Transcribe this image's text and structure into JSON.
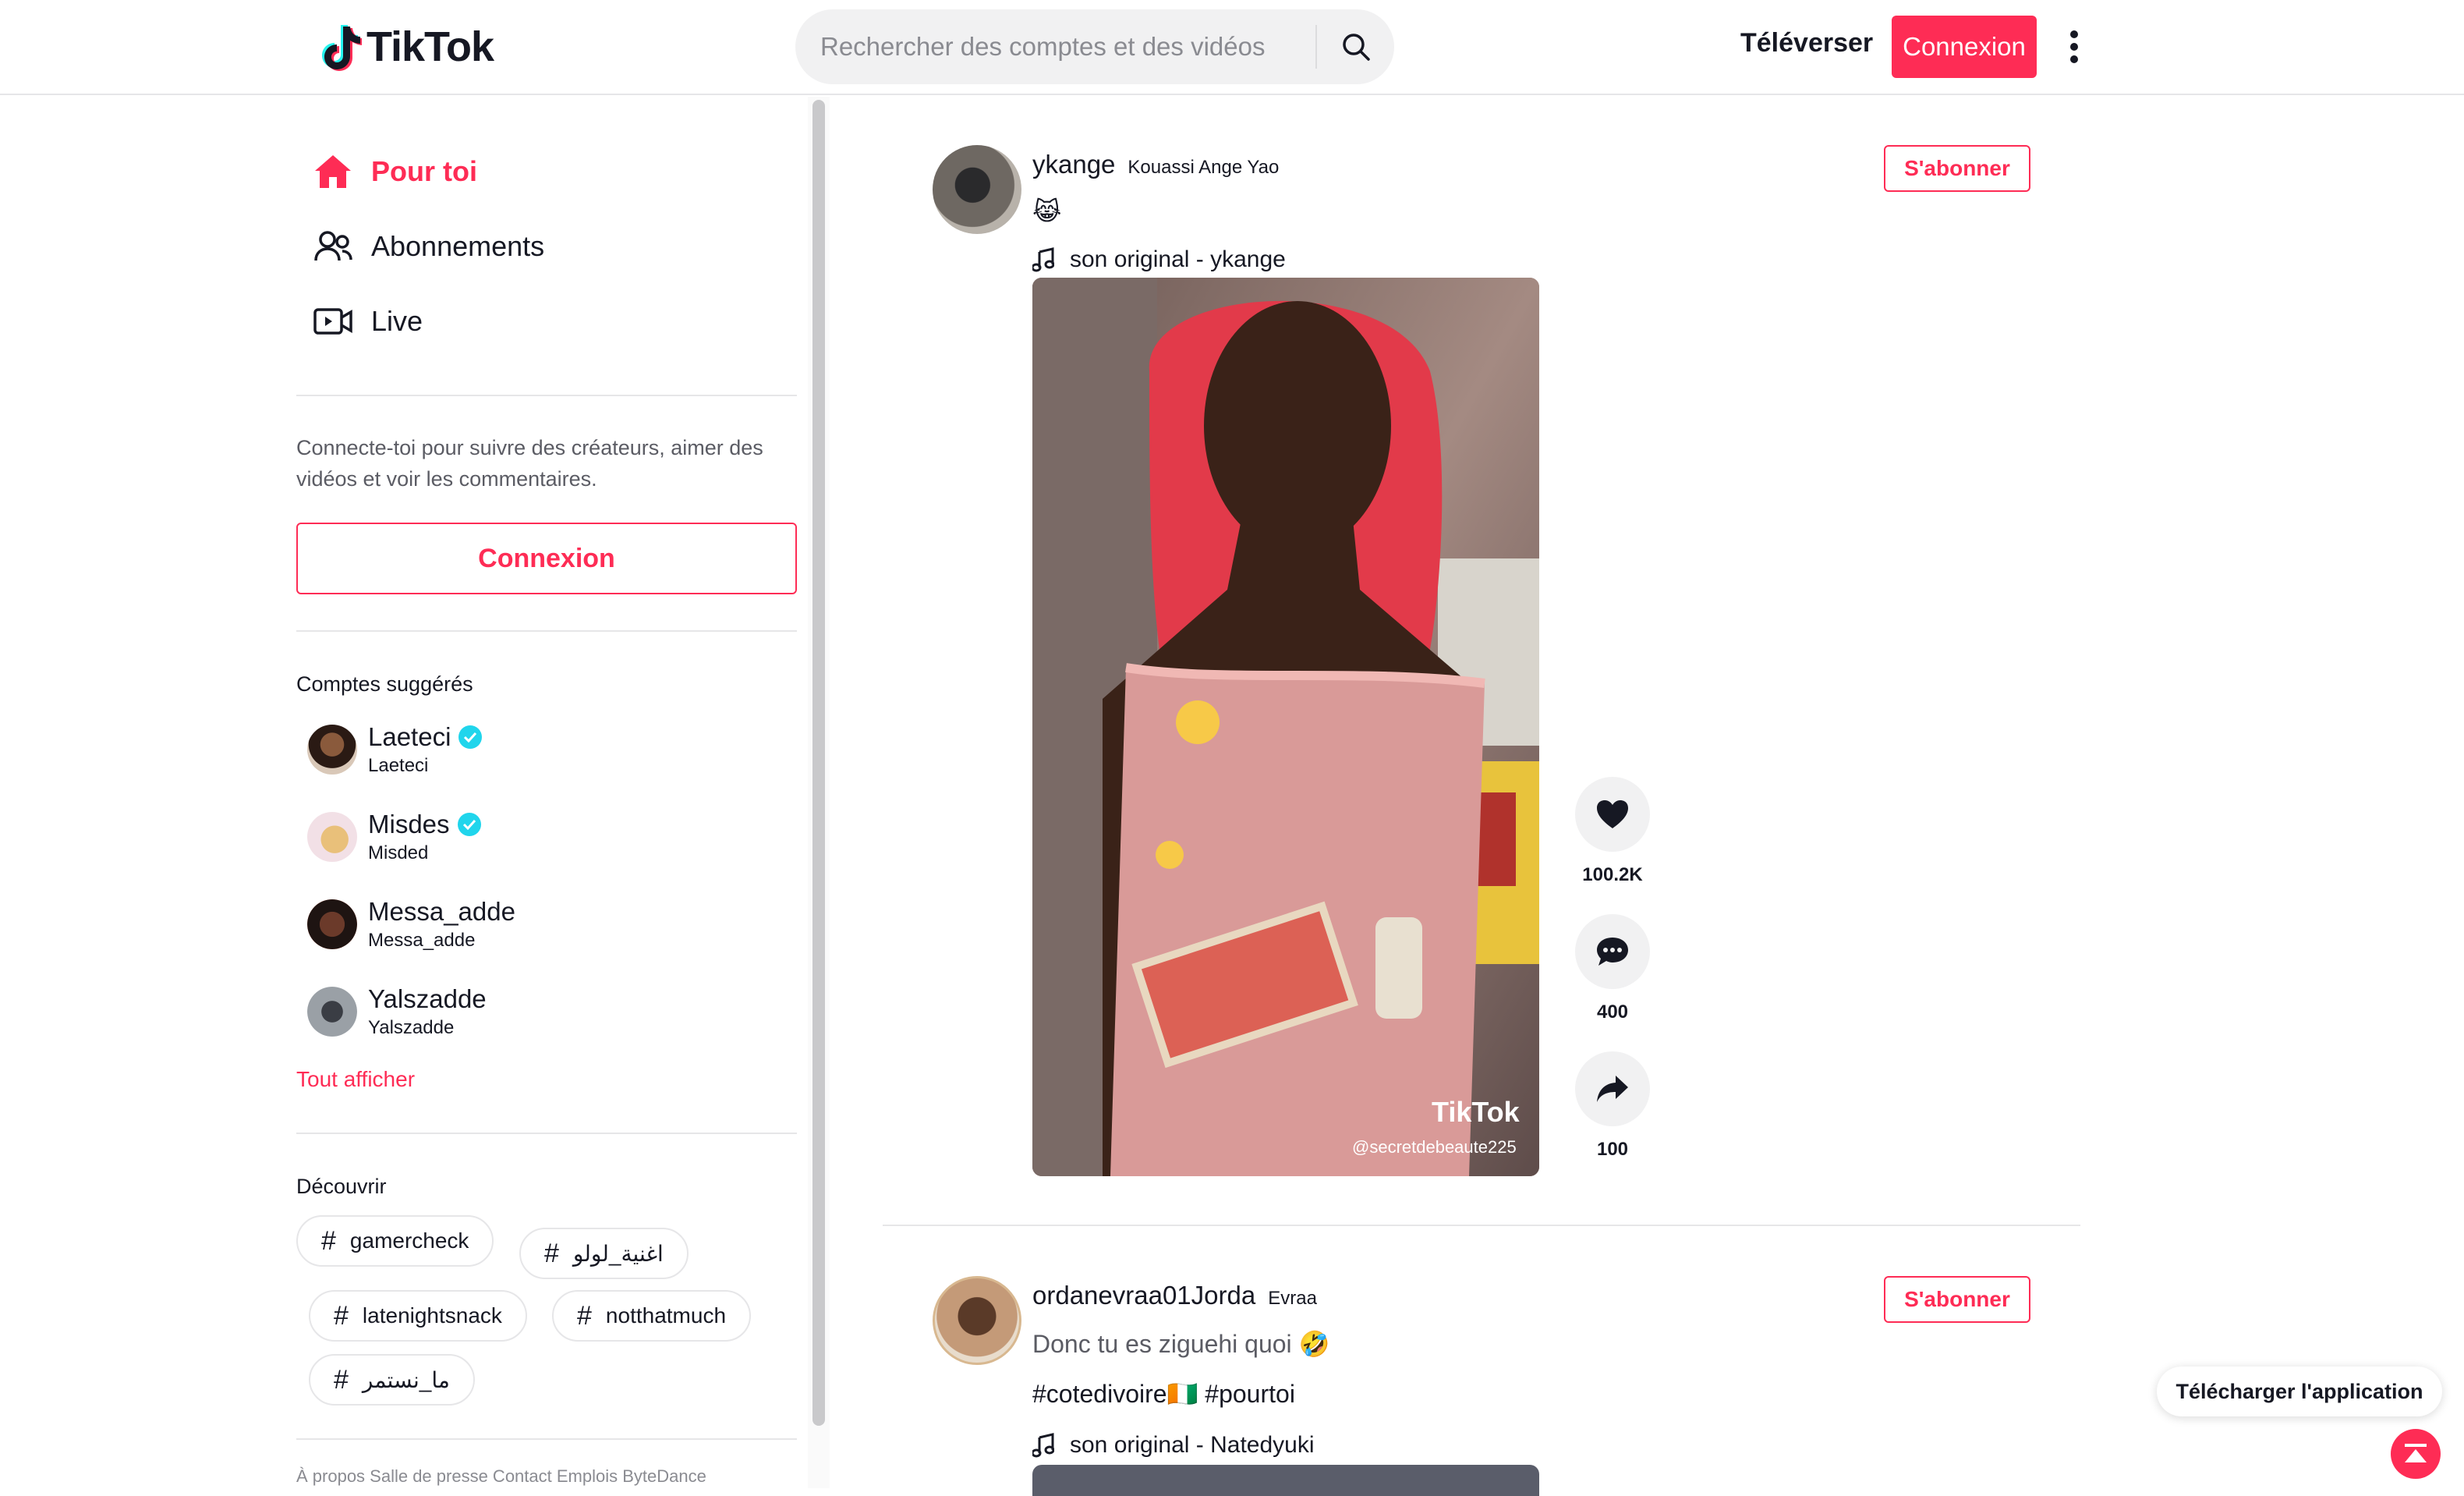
{
  "header": {
    "logo_text": "TikTok",
    "search_placeholder": "Rechercher des comptes et des vidéos",
    "upload_label": "Téléverser",
    "login_label": "Connexion"
  },
  "sidebar": {
    "nav": [
      {
        "label": "Pour toi",
        "icon": "home-icon",
        "active": true
      },
      {
        "label": "Abonnements",
        "icon": "people-icon",
        "active": false
      },
      {
        "label": "Live",
        "icon": "live-icon",
        "active": false
      }
    ],
    "login_hint": "Connecte-toi pour suivre des créateurs, aimer des vidéos et voir les commentaires.",
    "login_label": "Connexion",
    "suggested_title": "Comptes suggérés",
    "accounts": [
      {
        "name": "Laeteci",
        "sub": "Laeteci",
        "verified": true
      },
      {
        "name": "Misdes",
        "sub": "Misded",
        "verified": true
      },
      {
        "name": "Messa_adde",
        "sub": "Messa_adde",
        "verified": false
      },
      {
        "name": "Yalszadde",
        "sub": "Yalszadde",
        "verified": false
      }
    ],
    "see_all": "Tout afficher",
    "discover_title": "Découvrir",
    "tags": [
      "gamercheck",
      "اغنية_لولو",
      "latenightsnack",
      "notthatmuch",
      "ما_نستمر"
    ],
    "footer": "À propos  Salle de presse  Contact  Emplois  ByteDance"
  },
  "posts": [
    {
      "username": "ykange",
      "nickname": "Kouassi Ange Yao",
      "caption": "😹",
      "music": "son original - ykange",
      "follow_label": "S'abonner",
      "watermark_logo": "TikTok",
      "watermark_handle": "@secretdebeaute225",
      "likes": "100.2K",
      "comments": "400",
      "shares": "100"
    },
    {
      "username": "ordanevraa01Jorda",
      "nickname": "Evraa",
      "caption": "Donc tu es ziguehi quoi 🤣",
      "hashtags": "#cotedivoire🇨🇮 #pourtoi",
      "music": "son original - Natedyuki",
      "follow_label": "S'abonner"
    }
  ],
  "floating": {
    "get_app": "Télécharger l'application"
  },
  "colors": {
    "accent": "#fe2c55",
    "verified": "#20d5ec",
    "text": "#161823",
    "muted": "#8a8b91"
  }
}
